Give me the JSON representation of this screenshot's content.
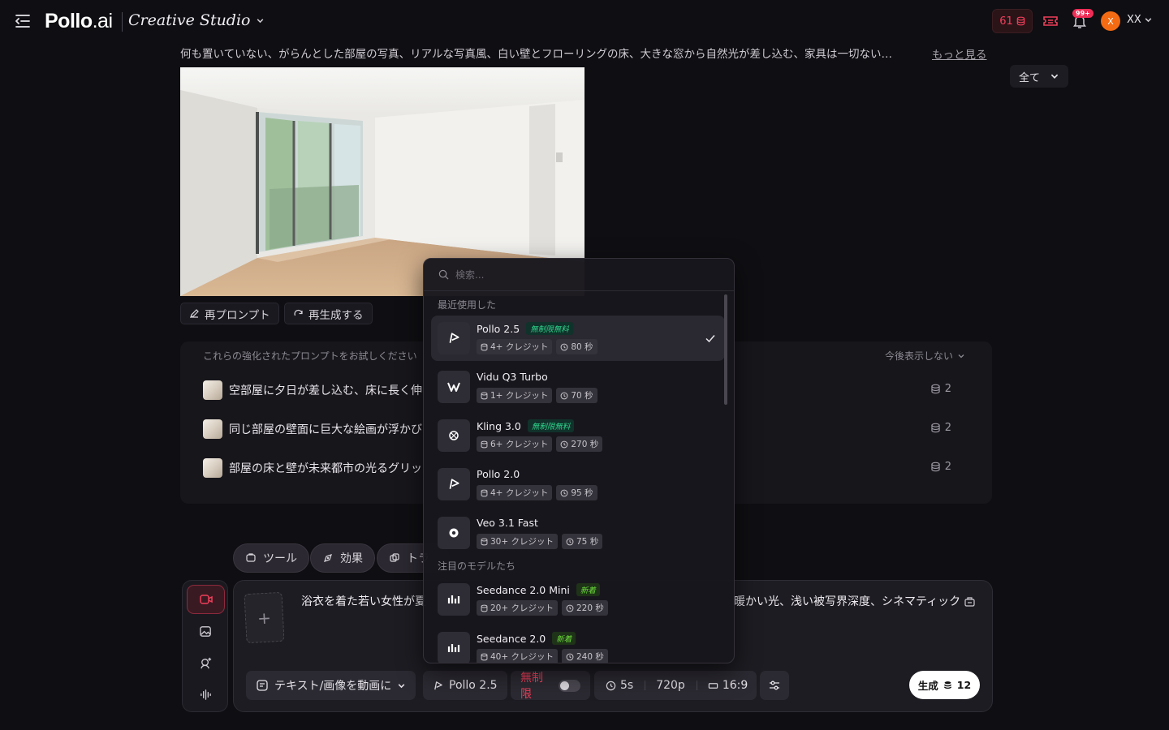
{
  "header": {
    "logo_main": "Pollo",
    "logo_suffix": ".ai",
    "studio_title": "Creative Studio",
    "credits": "61",
    "notification_badge": "99+",
    "avatar_initial": "X",
    "user_name": "XX"
  },
  "feed": {
    "prompt_text": "何も置いていない、がらんとした部屋の写真、リアルな写真風、白い壁とフローリングの床、大きな窓から自然光が差し込む、家具は一切ない…",
    "more_link": "もっと見る",
    "filter_label": "全て",
    "reprompt_label": "再プロンプト",
    "regenerate_label": "再生成する"
  },
  "suggestions": {
    "title": "これらの強化されたプロンプトをお試しください",
    "hide_label": "今後表示しない",
    "items": [
      {
        "text": "空部屋に夕日が差し込む、床に長く伸",
        "cost": "2"
      },
      {
        "text": "同じ部屋の壁面に巨大な絵画が浮かび",
        "cost": "2"
      },
      {
        "text": "部屋の床と壁が未来都市の光るグリッ",
        "cost": "2"
      }
    ]
  },
  "chips": {
    "tools": "ツール",
    "effects": "効果",
    "transitions": "トラ"
  },
  "composer": {
    "prompt_left": "浴衣を着た若い女性が夏",
    "prompt_right": "暖かい光、浅い被写界深度、シネマティック",
    "mode_label": "テキスト/画像を動画に",
    "model_label": "Pollo 2.5",
    "unlimited_label": "無制限",
    "duration": "5s",
    "resolution": "720p",
    "aspect": "16:9",
    "generate_label": "生成",
    "generate_cost": "12"
  },
  "model_dropdown": {
    "search_placeholder": "検索...",
    "recent_title": "最近使用した",
    "featured_title": "注目のモデルたち",
    "recent": [
      {
        "name": "Pollo 2.5",
        "tag": "無制限無料",
        "credits": "4+ クレジット",
        "time": "80 秒",
        "selected": true
      },
      {
        "name": "Vidu Q3 Turbo",
        "tag": "",
        "credits": "1+ クレジット",
        "time": "70 秒"
      },
      {
        "name": "Kling 3.0",
        "tag": "無制限無料",
        "credits": "6+ クレジット",
        "time": "270 秒"
      },
      {
        "name": "Pollo 2.0",
        "tag": "",
        "credits": "4+ クレジット",
        "time": "95 秒"
      },
      {
        "name": "Veo 3.1 Fast",
        "tag": "",
        "credits": "30+ クレジット",
        "time": "75 秒"
      }
    ],
    "featured": [
      {
        "name": "Seedance 2.0 Mini",
        "tag": "新着",
        "credits": "20+ クレジット",
        "time": "220 秒"
      },
      {
        "name": "Seedance 2.0",
        "tag": "新着",
        "credits": "40+ クレジット",
        "time": "240 秒"
      }
    ]
  },
  "colors": {
    "accent_red": "#ef3f5a",
    "avatar_orange": "#f46b13",
    "free_tag_green": "#2fd18b",
    "new_tag_green": "#6ddc3c"
  },
  "icons": [
    "menu-icon",
    "chevron-down-icon",
    "coin-icon",
    "ticket-icon",
    "bell-icon",
    "edit-icon",
    "refresh-icon",
    "tool-icon",
    "effect-icon",
    "transition-icon",
    "video-mode-icon",
    "image-mode-icon",
    "avatar-mode-icon",
    "audio-mode-icon",
    "plus-icon",
    "text-icon",
    "clock-icon",
    "aspect-icon",
    "sliders-icon",
    "search-icon",
    "check-icon",
    "pollo-logo-icon",
    "vidu-logo-icon",
    "kling-logo-icon",
    "veo-logo-icon",
    "seedance-logo-icon"
  ]
}
